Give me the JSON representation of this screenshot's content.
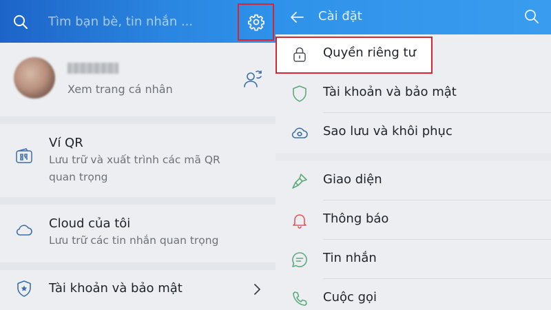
{
  "left": {
    "search": {
      "placeholder": "Tìm bạn bè, tin nhắn ..."
    },
    "profile": {
      "subtitle": "Xem trang cá nhân"
    },
    "items": [
      {
        "title": "Ví QR",
        "desc": "Lưu trữ và xuất trình các mã QR quan trọng",
        "icon": "qr-wallet-icon"
      },
      {
        "title": "Cloud của tôi",
        "desc": "Lưu trữ các tin nhắn quan trọng",
        "icon": "cloud-icon"
      },
      {
        "title": "Tài khoản và bảo mật",
        "icon": "shield-star-icon"
      }
    ]
  },
  "right": {
    "title": "Cài đặt",
    "items": [
      {
        "label": "Quyền riêng tư",
        "icon": "lock-icon"
      },
      {
        "label": "Tài khoản và bảo mật",
        "icon": "shield-icon"
      },
      {
        "label": "Sao lưu và khôi phục",
        "icon": "cloud-sync-icon"
      },
      {
        "label": "Giao diện",
        "icon": "brush-icon"
      },
      {
        "label": "Thông báo",
        "icon": "bell-icon"
      },
      {
        "label": "Tin nhắn",
        "icon": "chat-icon"
      },
      {
        "label": "Cuộc gọi",
        "icon": "phone-icon"
      }
    ]
  },
  "colors": {
    "header_blue": "#2f92ea",
    "highlight_red": "#d9262d",
    "icon_blue": "#3b6ea8",
    "icon_green": "#5aaa7a",
    "icon_red": "#e0565b"
  }
}
